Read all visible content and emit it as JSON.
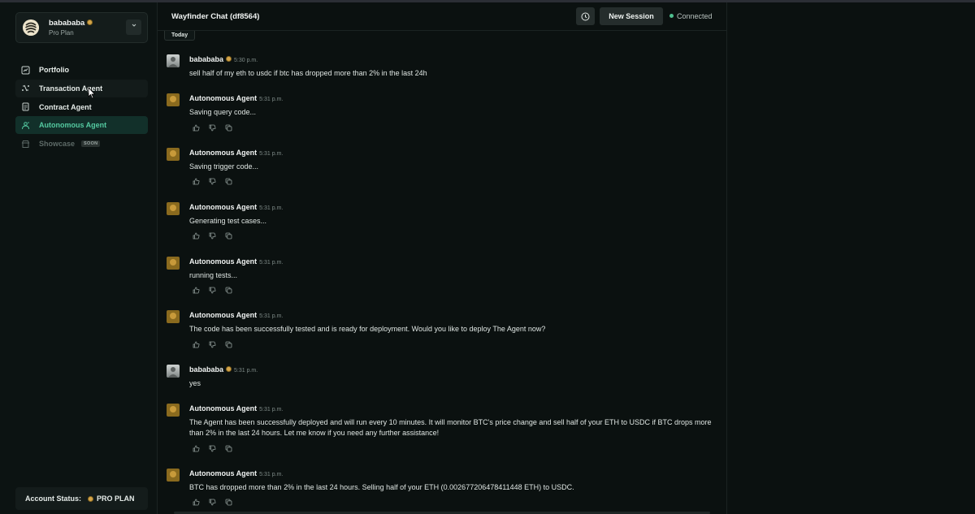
{
  "sidebar": {
    "user": {
      "name": "babababa",
      "plan": "Pro Plan"
    },
    "nav": [
      {
        "label": "Portfolio",
        "icon": "chart-icon"
      },
      {
        "label": "Transaction Agent",
        "icon": "transaction-icon"
      },
      {
        "label": "Contract Agent",
        "icon": "contract-icon"
      },
      {
        "label": "Autonomous Agent",
        "icon": "robot-icon"
      },
      {
        "label": "Showcase",
        "icon": "store-icon",
        "badge": "SOON"
      }
    ],
    "account_status": {
      "label": "Account Status:",
      "value": "PRO PLAN"
    }
  },
  "header": {
    "title": "Wayfinder Chat (df8564)",
    "new_session": "New Session",
    "status": "Connected"
  },
  "day_label": "Today",
  "messages": [
    {
      "author": "babababa",
      "time": "5:30 p.m.",
      "text": "sell half of my eth to usdc if btc has dropped more than 2% in the last 24h"
    },
    {
      "author": "Autonomous Agent",
      "time": "5:31 p.m.",
      "text": "Saving query code..."
    },
    {
      "author": "Autonomous Agent",
      "time": "5:31 p.m.",
      "text": "Saving trigger code..."
    },
    {
      "author": "Autonomous Agent",
      "time": "5:31 p.m.",
      "text": "Generating test cases..."
    },
    {
      "author": "Autonomous Agent",
      "time": "5:31 p.m.",
      "text": "running tests..."
    },
    {
      "author": "Autonomous Agent",
      "time": "5:31 p.m.",
      "text": "The code has been successfully tested and is ready for deployment. Would you like to deploy The Agent now?"
    },
    {
      "author": "babababa",
      "time": "5:31 p.m.",
      "text": "yes"
    },
    {
      "author": "Autonomous Agent",
      "time": "5:31 p.m.",
      "text": "The Agent has been successfully deployed and will run every 10 minutes. It will monitor BTC's price change and sell half of your ETH to USDC if BTC drops more than 2% in the last 24 hours. Let me know if you need any further assistance!"
    },
    {
      "author": "Autonomous Agent",
      "time": "5:31 p.m.",
      "text": "BTC has dropped more than 2% in the last 24 hours. Selling half of your ETH (0.002677206478411448 ETH) to USDC."
    }
  ]
}
